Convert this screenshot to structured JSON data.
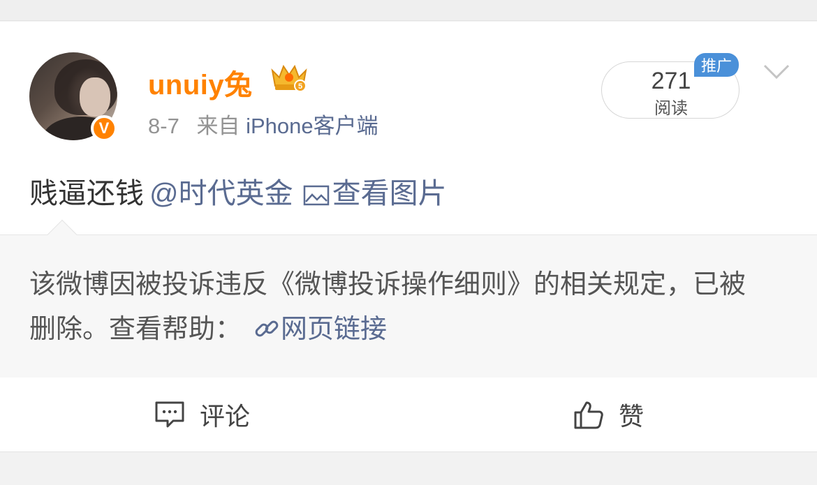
{
  "post": {
    "username": "unuiy兔",
    "date": "8-7",
    "source_prefix": "来自",
    "source_link": "iPhone客户端",
    "verified_badge": "V",
    "text": "贱逼还钱",
    "mention": "@时代英金",
    "image_link": "查看图片"
  },
  "read_stats": {
    "count": "271",
    "label": "阅读",
    "promo_tag": "推广"
  },
  "notice": {
    "text": "该微博因被投诉违反《微博投诉操作细则》的相关规定，已被删除。查看帮助：",
    "link_text": "网页链接"
  },
  "actions": {
    "comment_label": "评论",
    "like_label": "赞"
  },
  "icons": {
    "crown": "vip-crown-icon",
    "chevron": "chevron-down-icon",
    "picture": "picture-icon",
    "link": "link-icon",
    "comment": "comment-icon",
    "like": "thumbs-up-icon"
  },
  "colors": {
    "username": "#ff8200",
    "link": "#5a6b91",
    "promo_tag": "#4a90d9",
    "verified_badge": "#ff8200"
  }
}
